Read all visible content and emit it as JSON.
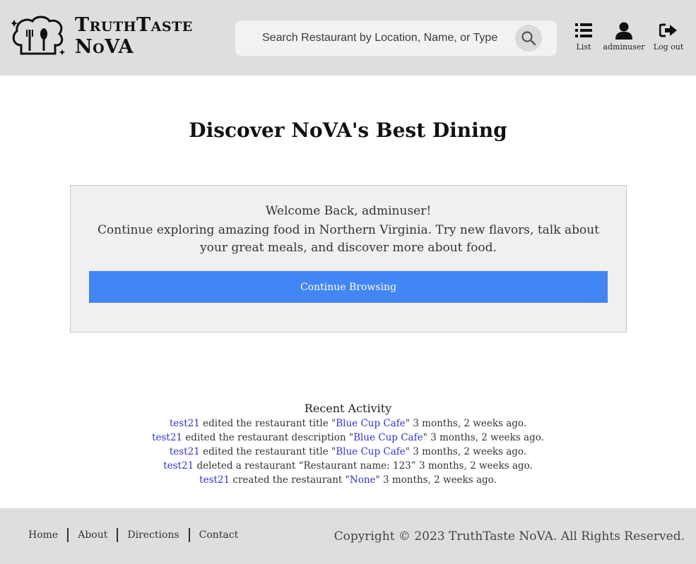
{
  "header": {
    "brand_line1": "TruthTaste",
    "brand_line2": "NoVA",
    "search": {
      "placeholder": "Search Restaurant by Location, Name, or Type"
    },
    "nav": {
      "list_label": "List",
      "user_label": "adminuser",
      "logout_label": "Log out"
    }
  },
  "main": {
    "title": "Discover NoVA's Best Dining",
    "welcome": {
      "greeting": "Welcome Back, adminuser!",
      "text": "Continue exploring amazing food in Northern Virginia. Try new flavors, talk about your great meals, and discover more about food.",
      "button_label": "Continue Browsing"
    },
    "activity": {
      "title": "Recent Activity",
      "items": [
        {
          "user": "test21",
          "action": " edited the restaurant title \"",
          "target": "Blue Cup Cafe",
          "suffix": "\" 3 months, 2 weeks ago."
        },
        {
          "user": "test21",
          "action": " edited the restaurant description \"",
          "target": "Blue Cup Cafe",
          "suffix": "\" 3 months, 2 weeks ago."
        },
        {
          "user": "test21",
          "action": " edited the restaurant title \"",
          "target": "Blue Cup Cafe",
          "suffix": "\" 3 months, 2 weeks ago."
        },
        {
          "user": "test21",
          "action": " deleted a restaurant “Restaurant name: 123” 3 months, 2 weeks ago.",
          "target": "",
          "suffix": ""
        },
        {
          "user": "test21",
          "action": " created the restaurant \"",
          "target": "None",
          "suffix": "\" 3 months, 2 weeks ago."
        }
      ]
    }
  },
  "footer": {
    "links": [
      "Home",
      "About",
      "Directions",
      "Contact"
    ],
    "copyright": "Copyright © 2023 TruthTaste NoVA. All Rights Reserved."
  },
  "colors": {
    "header_bg": "#dedede",
    "button_blue": "#4285f4",
    "link_blue": "#3333cc",
    "welcome_bg": "#f0f0f0"
  },
  "icons": [
    "chef-hat-logo-icon",
    "search-icon",
    "list-icon",
    "user-icon",
    "logout-icon"
  ]
}
